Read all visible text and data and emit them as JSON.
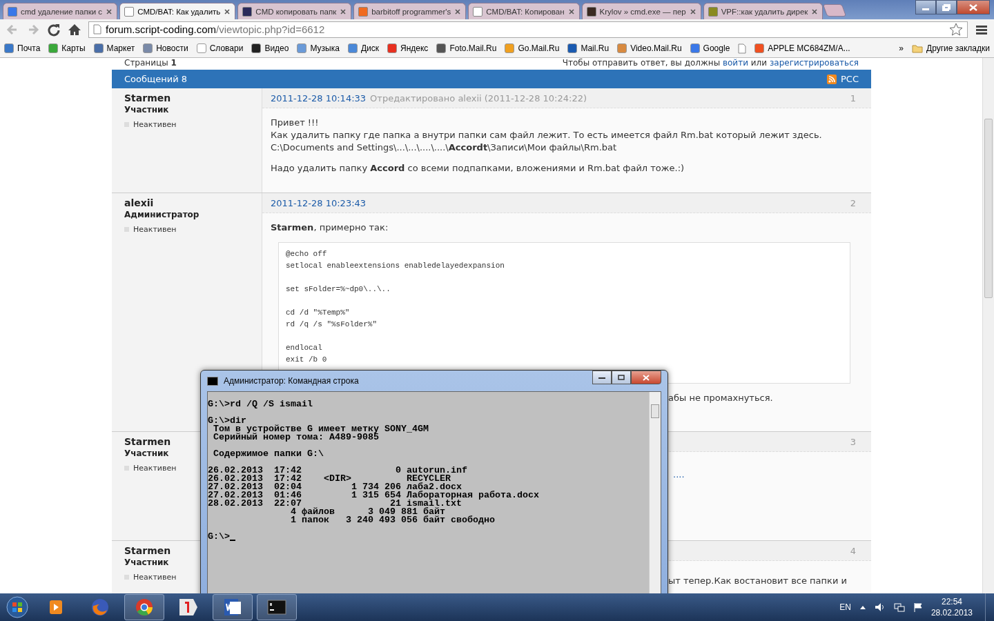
{
  "browser": {
    "tabs": [
      {
        "title": "cmd удаление папки с",
        "selected": false
      },
      {
        "title": "CMD/BAT: Как удалить",
        "selected": true
      },
      {
        "title": "CMD копировать папк",
        "selected": false
      },
      {
        "title": "barbitoff programmer's",
        "selected": false
      },
      {
        "title": "CMD/BAT: Копирован",
        "selected": false
      },
      {
        "title": "Krylov » cmd.exe — пер",
        "selected": false
      },
      {
        "title": "VPF::как удалить дирек",
        "selected": false
      }
    ],
    "address": {
      "host": "forum.script-coding.com",
      "path": "/viewtopic.php?id=6612"
    },
    "bookmarks": [
      {
        "kind": "link",
        "label": "Почта"
      },
      {
        "kind": "link",
        "label": "Карты"
      },
      {
        "kind": "link",
        "label": "Маркет"
      },
      {
        "kind": "link",
        "label": "Новости"
      },
      {
        "kind": "link",
        "label": "Словари"
      },
      {
        "kind": "link",
        "label": "Видео"
      },
      {
        "kind": "link",
        "label": "Музыка"
      },
      {
        "kind": "link",
        "label": "Диск"
      },
      {
        "kind": "link",
        "label": "Яндекс"
      },
      {
        "kind": "link",
        "label": "Foto.Mail.Ru"
      },
      {
        "kind": "link",
        "label": "Go.Mail.Ru"
      },
      {
        "kind": "link",
        "label": "Mail.Ru"
      },
      {
        "kind": "link",
        "label": "Video.Mail.Ru"
      },
      {
        "kind": "link",
        "label": "Google"
      },
      {
        "kind": "blank"
      },
      {
        "kind": "link",
        "label": "APPLE MC684ZM/A..."
      }
    ],
    "more": "»",
    "other_bookmarks": "Другие закладки"
  },
  "forum": {
    "pages_label": "Страницы",
    "pages_current": "1",
    "reply_note": "Чтобы отправить ответ, вы должны",
    "login_link": "войти",
    "or_word": "или",
    "register_link": "зарегистрироваться",
    "posts_header": "Сообщений 8",
    "rss": "РСС",
    "posts": [
      {
        "author": "Starmen",
        "role": "Участник",
        "status": "Неактивен",
        "date": "2011-12-28 10:14:33",
        "edited": "Отредактировано alexii (2011-12-28 10:24:22)",
        "number": "1",
        "body": [
          {
            "kind": "paragraph",
            "lines": [
              "Привет !!!",
              "Как удалить папку где папка а внутри папки сам файл лежит. То есть имеется файл Rm.bat который лежит здесь.",
              "C:\\Documents and Settings\\...\\...\\....\\....\\**Accordt**\\Записи\\Мои файлы\\Rm.bat"
            ]
          },
          {
            "kind": "paragraph",
            "lines": [
              "Надо удалить папку **Accord** со всеми подпапками, вложениями и Rm.bat файл тоже.:)"
            ]
          }
        ]
      },
      {
        "author": "alexii",
        "role": "Администратор",
        "status": "Неактивен",
        "date": "2011-12-28 10:23:43",
        "number": "2",
        "body": [
          {
            "kind": "paragraph",
            "lines": [
              "**Starmen**, примерно так:"
            ]
          },
          {
            "kind": "code",
            "groups": [
              [
                "@echo off",
                "setlocal enableextensions enabledelayedexpansion"
              ],
              [
                "set sFolder=%~dp0\\..\\.."
              ],
              [
                "cd /d \"%Temp%\"",
                "rd /q /s \"%sFolder%\""
              ],
              [
                "endlocal",
                "exit /b 0"
              ]
            ]
          },
          {
            "kind": "fragment",
            "text": "абы не промахнуться."
          }
        ]
      },
      {
        "author": "Starmen",
        "role": "Участник",
        "status": "Неактивен",
        "number": "3",
        "body": [
          {
            "kind": "link_fragment",
            "text": "...."
          }
        ]
      },
      {
        "author": "Starmen",
        "role": "Участник",
        "status": "Неактивен",
        "number": "4",
        "body": [
          {
            "kind": "fragment",
            "text": "ыт тепер.Как востановит все папки и"
          }
        ]
      }
    ]
  },
  "console": {
    "title": "Администратор: Командная строка",
    "blocks": [
      [
        "G:\\>rd /Q /S ismail"
      ],
      [
        "G:\\>dir",
        " Том в устройстве G имеет метку SONY_4GM",
        " Серийный номер тома: A489-9085"
      ],
      [
        " Содержимое папки G:\\"
      ],
      [
        "26.02.2013  17:42                 0 autorun.inf",
        "26.02.2013  17:42    <DIR>          RECYCLER",
        "27.02.2013  02:04         1 734 206 лаба2.docx",
        "27.02.2013  01:46         1 315 654 Лабораторная работа.docx",
        "28.02.2013  22:07                21 ismail.txt",
        "               4 файлов      3 049 881 байт",
        "               1 папок   3 240 493 056 байт свободно"
      ],
      [
        "G:\\>"
      ]
    ]
  },
  "taskbar": {
    "apps": [
      {
        "kind": "media",
        "running": false
      },
      {
        "kind": "firefox",
        "running": false
      },
      {
        "kind": "chrome",
        "running": true
      },
      {
        "kind": "yandex",
        "running": false
      },
      {
        "kind": "word",
        "running": true
      },
      {
        "kind": "console",
        "running": true
      }
    ],
    "language": "EN",
    "time": "22:54",
    "date": "28.02.2013"
  }
}
